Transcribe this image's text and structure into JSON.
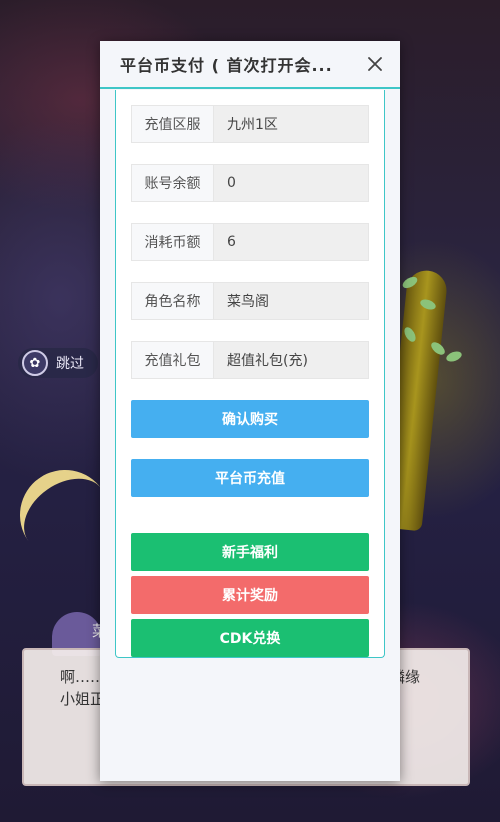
{
  "game": {
    "skip_label": "跳过",
    "skip_icon": "flower-icon",
    "dialog_left_line1": "啊……",
    "dialog_left_line2": "小姐正",
    "dialog_right_line1": "隣缘",
    "speaker_char": "菜"
  },
  "modal": {
    "title": "平台币支付 ( 首次打开会...",
    "close_icon": "close-icon",
    "fields": [
      {
        "label": "充值区服",
        "value": "九州1区"
      },
      {
        "label": "账号余额",
        "value": "0"
      },
      {
        "label": "消耗币额",
        "value": "6"
      },
      {
        "label": "角色名称",
        "value": "菜鸟阁"
      },
      {
        "label": "充值礼包",
        "value": "超值礼包(充)"
      }
    ],
    "buttons": {
      "confirm_purchase": "确认购买",
      "platform_recharge": "平台币充值",
      "newbie_welfare": "新手福利",
      "cumulative_reward": "累计奖励",
      "cdk_exchange": "CDK兑换"
    }
  },
  "colors": {
    "accent_teal": "#3ec6c7",
    "blue_button": "#45aff0",
    "green_button": "#1bbf72",
    "red_button": "#f36b6b"
  }
}
